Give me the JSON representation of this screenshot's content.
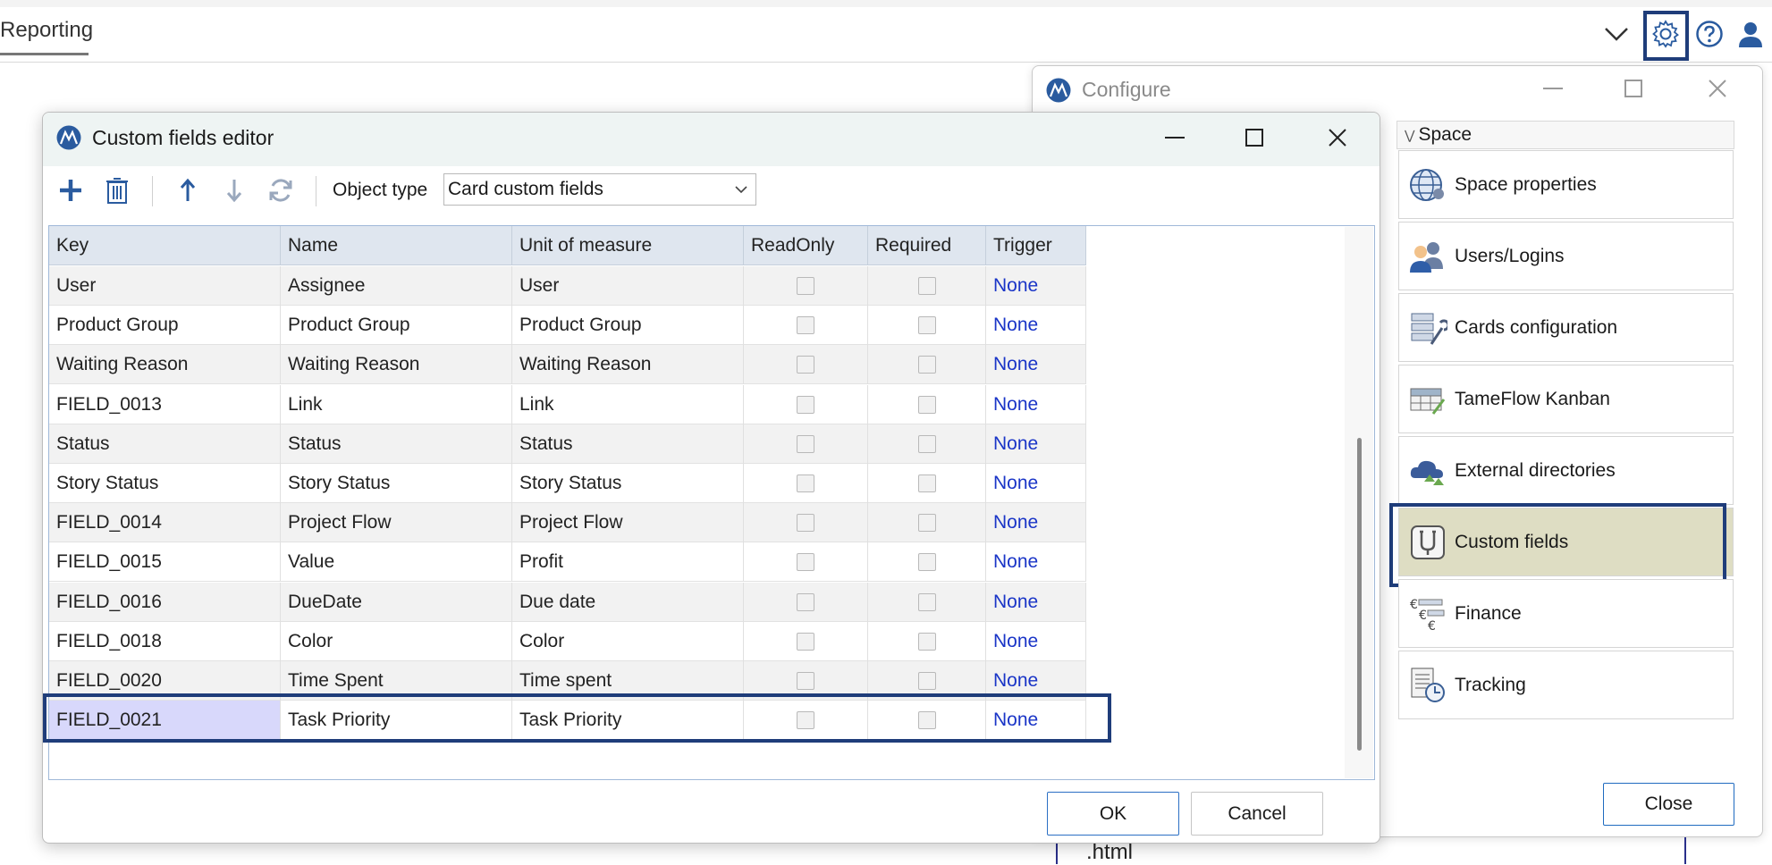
{
  "app": {
    "tab_label": "Reporting",
    "header_icons": [
      "chevron-down-icon",
      "gear-icon",
      "help-icon",
      "user-icon"
    ]
  },
  "configure": {
    "title": "Configure",
    "section": "Space",
    "items": [
      {
        "label": "Space properties",
        "icon": "globe-icon"
      },
      {
        "label": "Users/Logins",
        "icon": "users-icon"
      },
      {
        "label": "Cards configuration",
        "icon": "cards-config-icon"
      },
      {
        "label": "TameFlow Kanban",
        "icon": "kanban-grid-icon"
      },
      {
        "label": "External directories",
        "icon": "cloud-directory-icon"
      },
      {
        "label": "Custom fields",
        "icon": "custom-fields-icon",
        "selected": true
      },
      {
        "label": "Finance",
        "icon": "finance-icon"
      },
      {
        "label": "Tracking",
        "icon": "tracking-icon"
      }
    ],
    "close_label": "Close",
    "background_text": ".html"
  },
  "editor": {
    "title": "Custom fields editor",
    "object_type_label": "Object type",
    "object_type_value": "Card custom fields",
    "columns": [
      "Key",
      "Name",
      "Unit of measure",
      "ReadOnly",
      "Required",
      "Trigger"
    ],
    "rows": [
      {
        "key": "User",
        "name": "Assignee",
        "unit": "User",
        "readonly": false,
        "required": false,
        "trigger": "None"
      },
      {
        "key": "Product Group",
        "name": "Product Group",
        "unit": "Product Group",
        "readonly": false,
        "required": false,
        "trigger": "None"
      },
      {
        "key": "Waiting Reason",
        "name": "Waiting Reason",
        "unit": "Waiting Reason",
        "readonly": false,
        "required": false,
        "trigger": "None"
      },
      {
        "key": "FIELD_0013",
        "name": "Link",
        "unit": "Link",
        "readonly": false,
        "required": false,
        "trigger": "None"
      },
      {
        "key": "Status",
        "name": "Status",
        "unit": "Status",
        "readonly": false,
        "required": false,
        "trigger": "None"
      },
      {
        "key": "Story Status",
        "name": "Story Status",
        "unit": "Story Status",
        "readonly": false,
        "required": false,
        "trigger": "None"
      },
      {
        "key": "FIELD_0014",
        "name": "Project Flow",
        "unit": "Project Flow",
        "readonly": false,
        "required": false,
        "trigger": "None"
      },
      {
        "key": "FIELD_0015",
        "name": "Value",
        "unit": "Profit",
        "readonly": false,
        "required": false,
        "trigger": "None"
      },
      {
        "key": "FIELD_0016",
        "name": "DueDate",
        "unit": "Due date",
        "readonly": false,
        "required": false,
        "trigger": "None"
      },
      {
        "key": "FIELD_0018",
        "name": "Color",
        "unit": "Color",
        "readonly": false,
        "required": false,
        "trigger": "None"
      },
      {
        "key": "FIELD_0020",
        "name": "Time Spent",
        "unit": "Time spent",
        "readonly": false,
        "required": false,
        "trigger": "None"
      },
      {
        "key": "FIELD_0021",
        "name": "Task Priority",
        "unit": "Task Priority",
        "readonly": false,
        "required": false,
        "trigger": "None",
        "selected": true
      }
    ],
    "ok_label": "OK",
    "cancel_label": "Cancel"
  },
  "colors": {
    "accent_outline": "#1f3d7a",
    "trigger_link": "#1a35c7",
    "selected_nav": "#deddc3",
    "selected_key_cell": "#d8d8fb"
  }
}
